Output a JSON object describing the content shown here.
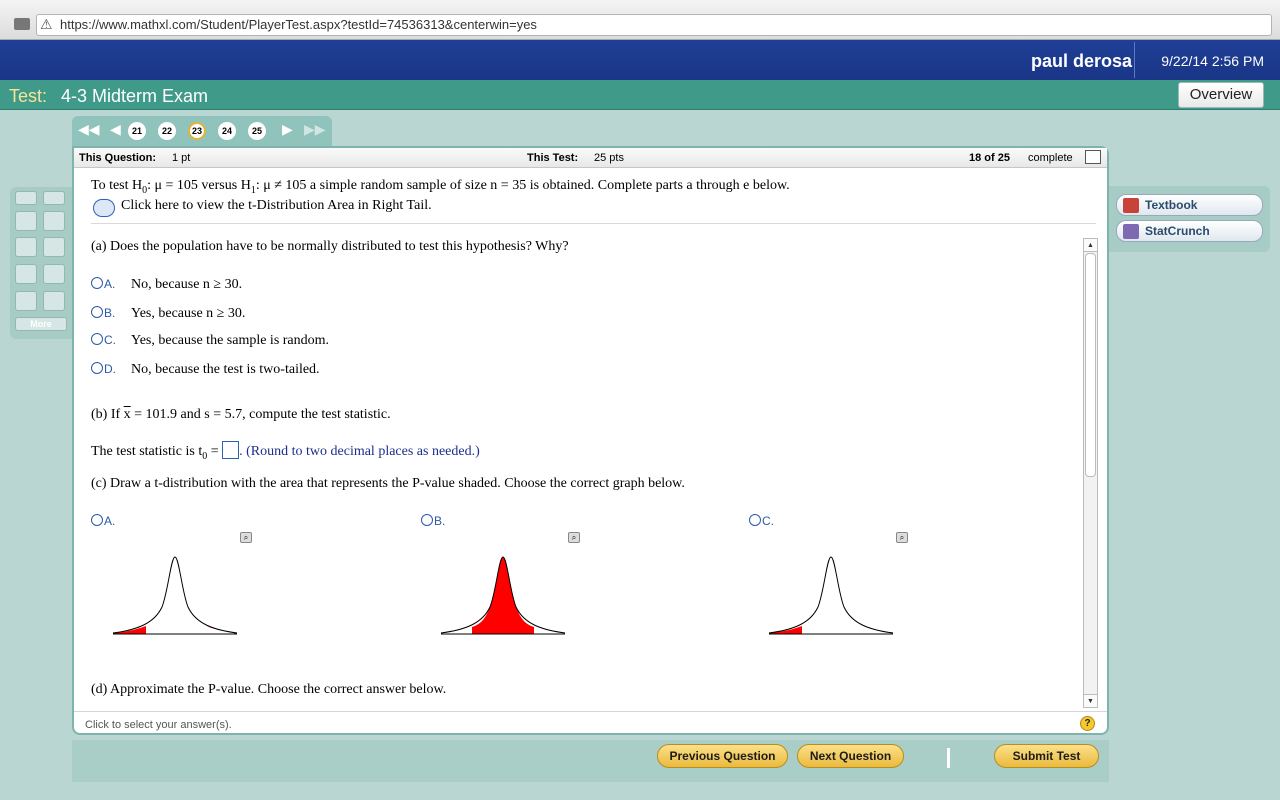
{
  "browser": {
    "url": "https://www.mathxl.com/Student/PlayerTest.aspx?testId=74536313&centerwin=yes"
  },
  "header": {
    "username": "paul derosa",
    "datetime": "9/22/14 2:56 PM"
  },
  "test": {
    "label": "Test:",
    "title": "4-3 Midterm Exam",
    "overview_label": "Overview"
  },
  "pager": {
    "first": "◀◀",
    "prev": "◀",
    "next": "▶",
    "last": "▶▶",
    "pages": [
      "21",
      "22",
      "23",
      "24",
      "25"
    ],
    "current": "23"
  },
  "question_info": {
    "this_question_label": "This Question:",
    "this_question_value": "1 pt",
    "this_test_label": "This Test:",
    "this_test_value": "25 pts",
    "progress": "18 of 25",
    "progress_suffix": "complete"
  },
  "stem": {
    "p1": "To test H",
    "s1": "0",
    "p2": ": μ = 105 versus H",
    "s2": "1",
    "p3": ": μ ≠ 105 a simple random sample of size n = 35 is obtained. Complete parts a through e below.",
    "table_link": "Click here to view the t-Distribution Area in Right Tail."
  },
  "part_a": {
    "question": "(a) Does the population have to be normally distributed to test this hypothesis? Why?",
    "options": [
      {
        "letter": "A.",
        "text": "No, because n ≥ 30."
      },
      {
        "letter": "B.",
        "text": "Yes, because n ≥ 30."
      },
      {
        "letter": "C.",
        "text": "Yes, because the sample is random."
      },
      {
        "letter": "D.",
        "text": "No, because the test is two-tailed."
      }
    ]
  },
  "part_b": {
    "q_prefix": "(b) If ",
    "xbar": "x",
    "q_suffix": " = 101.9 and s = 5.7, compute the test statistic.",
    "ans_prefix": "The test statistic is t",
    "ans_sub": "0",
    "ans_eq": " = ",
    "hint": ". (Round to two decimal places as needed.)"
  },
  "part_c": {
    "question": "(c) Draw a t-distribution with the area that represents the P-value shaded. Choose the correct graph below.",
    "options": [
      {
        "letter": "A.",
        "shade": "two-tails"
      },
      {
        "letter": "B.",
        "shade": "center"
      },
      {
        "letter": "C.",
        "shade": "left-tail"
      }
    ],
    "shade_color": "#ff0000"
  },
  "part_d": {
    "question": "(d) Approximate the P-value. Choose the correct answer below."
  },
  "footer": {
    "status": "Click to select your answer(s).",
    "help": "?"
  },
  "tools": {
    "more_label": "More"
  },
  "sidebar": {
    "textbook": "Textbook",
    "statcrunch": "StatCrunch"
  },
  "buttons": {
    "previous": "Previous Question",
    "next": "Next Question",
    "submit": "Submit Test"
  },
  "colors": {
    "blue_header": "#1f3f96",
    "teal_header": "#3f9a8a",
    "background": "#b9d6d2",
    "button_gold": "#f2c95c"
  }
}
